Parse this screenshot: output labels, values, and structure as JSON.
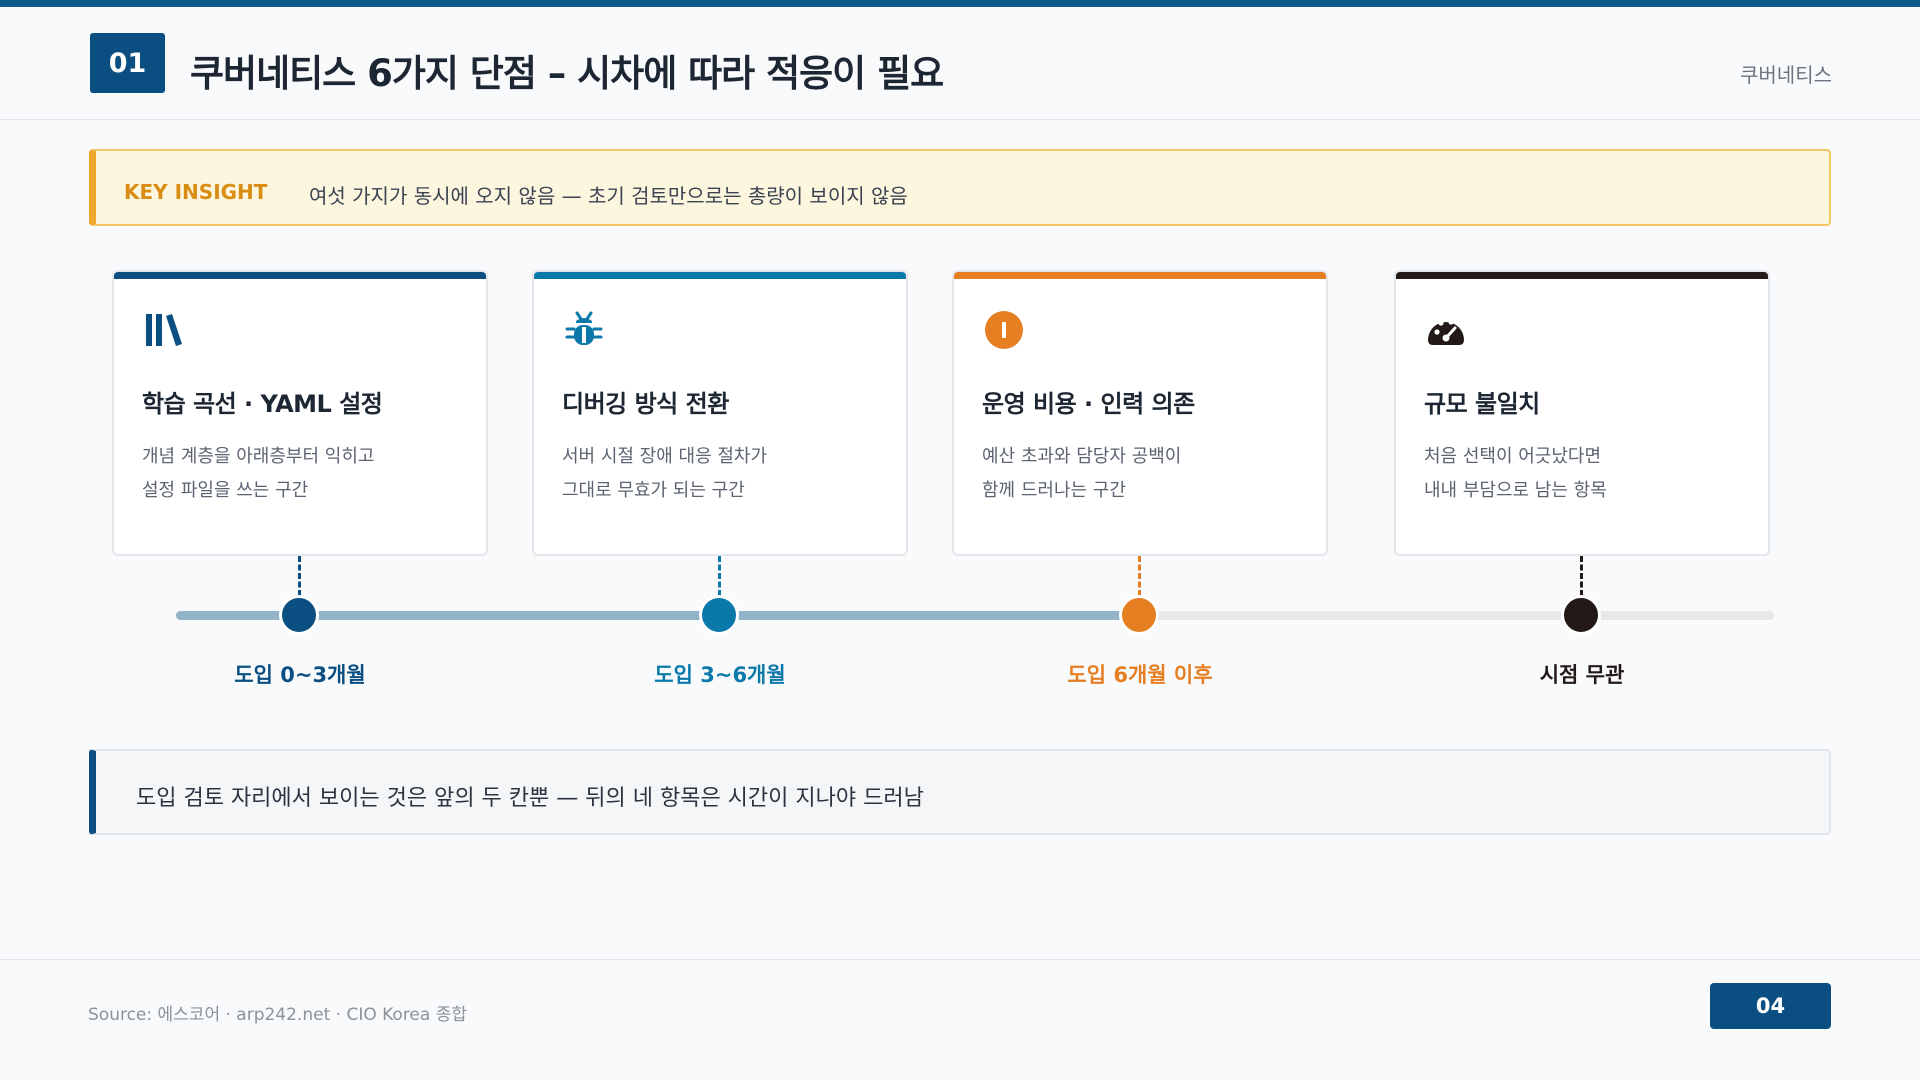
{
  "header": {
    "number": "01",
    "title": "쿠버네티스 6가지 단점 – 시차에 따라 적응이 필요",
    "tag": "쿠버네티스"
  },
  "insight": {
    "label": "KEY INSIGHT",
    "text": "여섯 가지가 동시에 오지 않음 — 초기 검토만으로는 총량이 보이지 않음"
  },
  "colors": {
    "navy": "#0b4f82",
    "blue": "#0b78aa",
    "orange": "#e67e22",
    "black": "#231a18"
  },
  "cards": [
    {
      "icon": "books-icon",
      "title": "학습 곡선 · YAML 설정",
      "desc_line1": "개념 계층을 아래층부터 익히고",
      "desc_line2": "설정 파일을 쓰는 구간",
      "color": "#0b4f82"
    },
    {
      "icon": "bug-icon",
      "title": "디버깅 방식 전환",
      "desc_line1": "서버 시절 장애 대응 절차가",
      "desc_line2": "그대로 무효가 되는 구간",
      "color": "#0b78aa"
    },
    {
      "icon": "alert-icon",
      "title": "운영 비용 · 인력 의존",
      "desc_line1": "예산 초과와 담당자 공백이",
      "desc_line2": "함께 드러나는 구간",
      "color": "#e67e22"
    },
    {
      "icon": "gauge-icon",
      "title": "규모 불일치",
      "desc_line1": "처음 선택이 어긋났다면",
      "desc_line2": "내내 부담으로 남는 항목",
      "color": "#231a18"
    }
  ],
  "timeline": {
    "milestones": [
      {
        "label": "도입 0~3개월",
        "color": "#0b4f82"
      },
      {
        "label": "도입 3~6개월",
        "color": "#0b78aa"
      },
      {
        "label": "도입 6개월 이후",
        "color": "#e67e22"
      },
      {
        "label": "시점 무관",
        "color": "#231a18"
      }
    ]
  },
  "summary": {
    "text": "도입 검토 자리에서 보이는 것은 앞의 두 칸뿐 — 뒤의 네 항목은 시간이 지나야 드러남"
  },
  "footer": {
    "source": "Source: 에스코어 · arp242.net · CIO Korea 종합",
    "page": "04"
  }
}
